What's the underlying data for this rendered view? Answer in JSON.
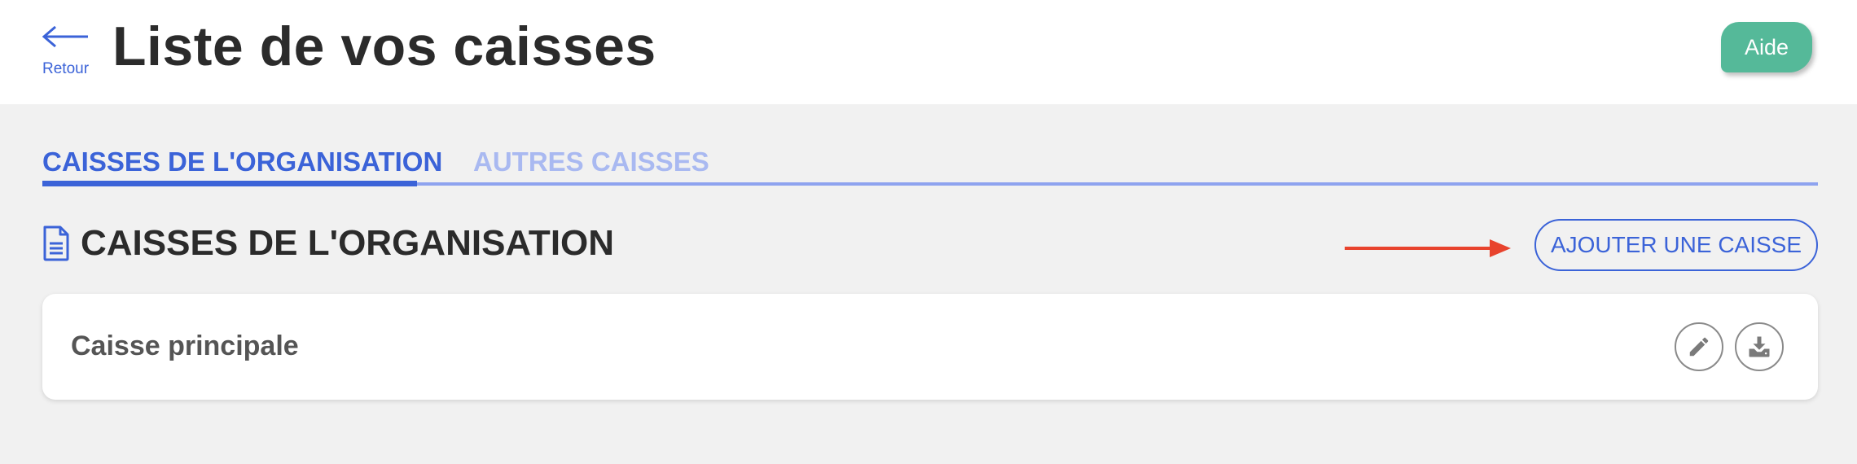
{
  "header": {
    "back_label": "Retour",
    "title": "Liste de vos caisses",
    "help_label": "Aide"
  },
  "tabs": [
    {
      "label": "CAISSES DE L'ORGANISATION",
      "active": true
    },
    {
      "label": "AUTRES CAISSES",
      "active": false
    }
  ],
  "section": {
    "title": "CAISSES DE L'ORGANISATION",
    "icon": "document-icon",
    "add_button_label": "AJOUTER UNE CAISSE"
  },
  "cashboxes": [
    {
      "name": "Caisse principale",
      "actions": [
        "pencil-icon",
        "download-icon"
      ]
    }
  ],
  "colors": {
    "accent": "#3b63d8",
    "accent_light": "#a9b9f1",
    "help_green": "#55b999",
    "annotation_arrow": "#e8432d",
    "title_text": "#2b2b2b"
  }
}
